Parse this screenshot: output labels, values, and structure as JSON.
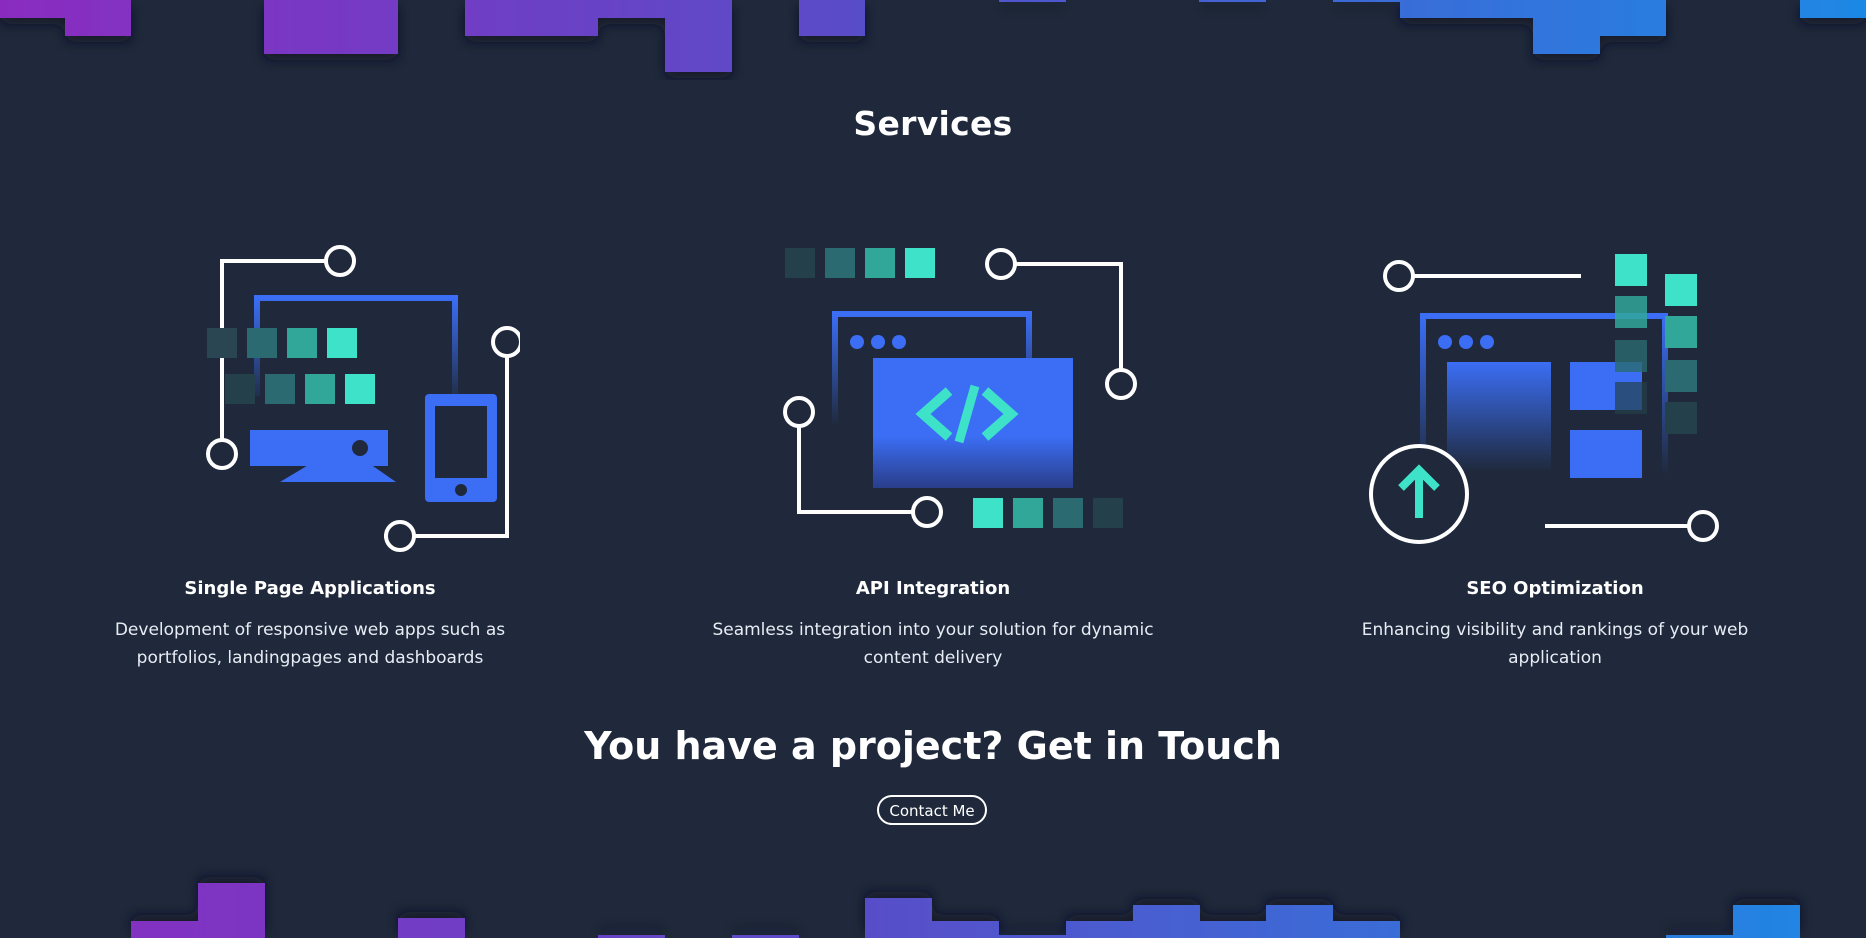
{
  "colors": {
    "background": "#1f293b",
    "accent_blue": "#3b6ef5",
    "accent_teal": "#3ee2c8",
    "gradient_purple": "#8a2cc0",
    "gradient_blue": "#1e88e5"
  },
  "services": {
    "title": "Services",
    "items": [
      {
        "title": "Single Page Applications",
        "description": "Development of responsive web apps such as portfolios, landingpages and dashboards",
        "icon": "spa-devices-illustration"
      },
      {
        "title": "API Integration",
        "description": "Seamless integration into your solution for dynamic content delivery",
        "icon": "api-code-illustration"
      },
      {
        "title": "SEO Optimization",
        "description": "Enhancing visibility and rankings of your web application",
        "icon": "seo-upload-illustration"
      }
    ]
  },
  "cta": {
    "title": "You have a project? Get in Touch",
    "button_label": "Contact Me"
  }
}
